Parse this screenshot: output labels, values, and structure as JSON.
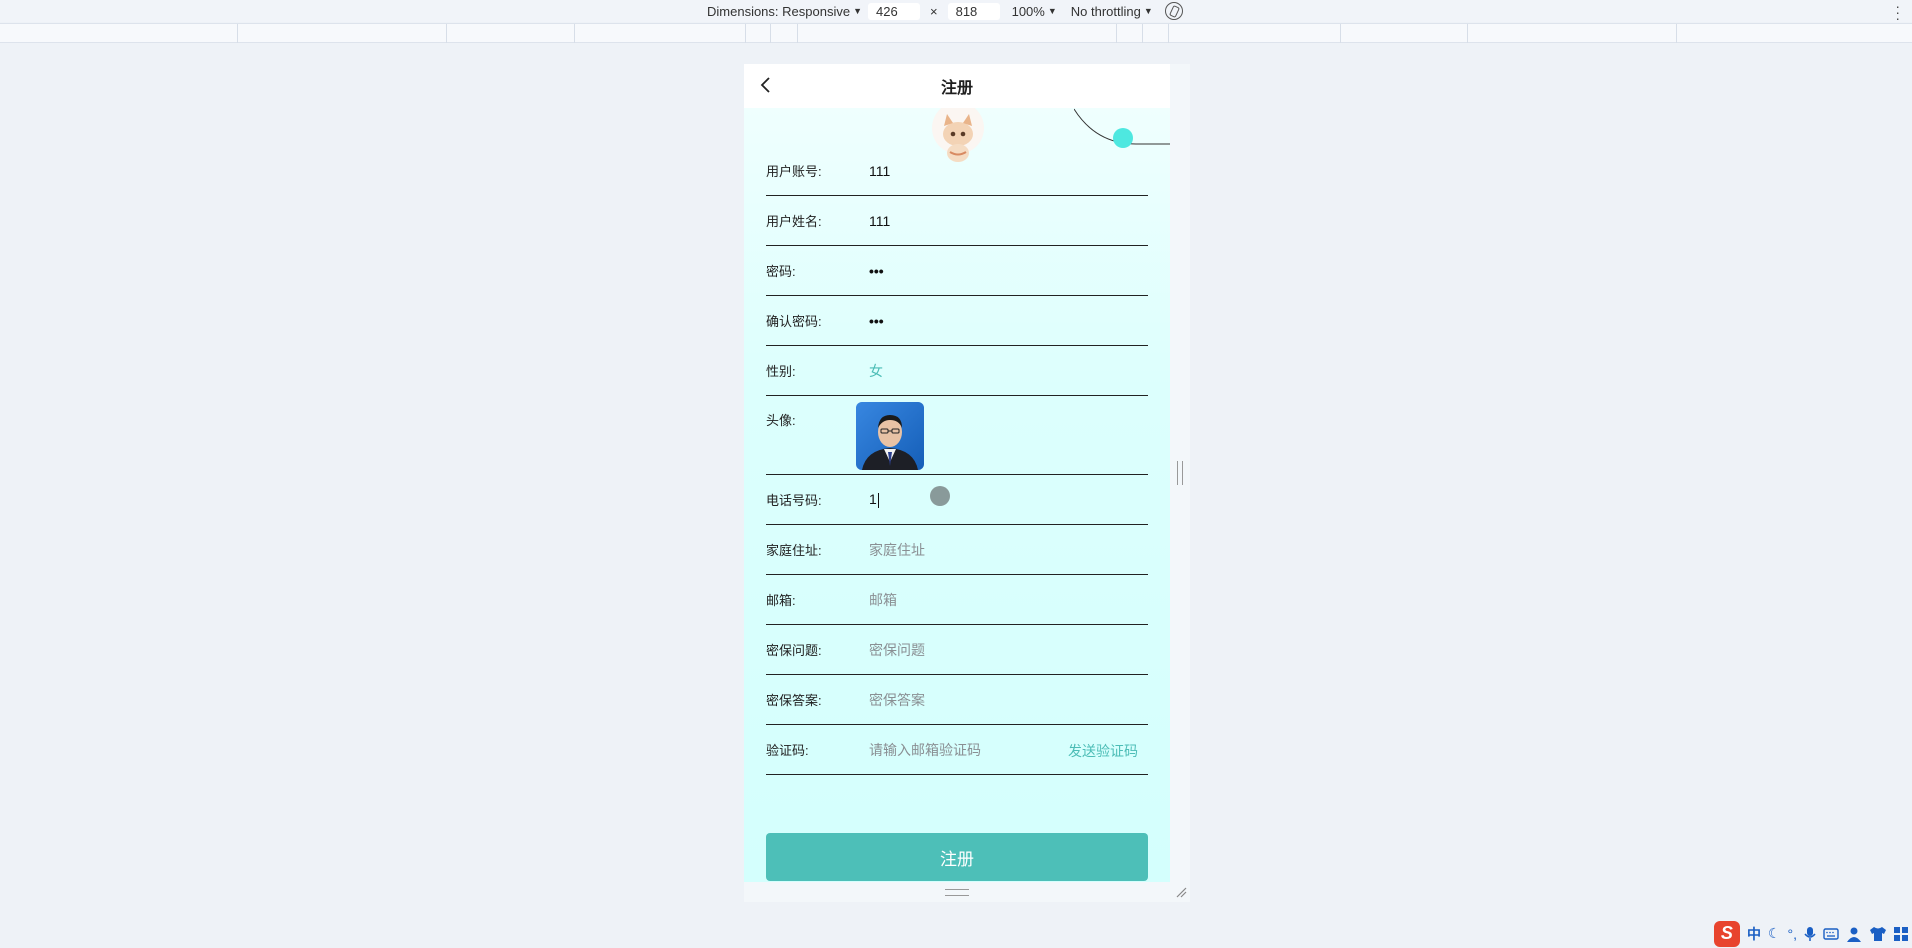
{
  "devtools": {
    "dimensions_label": "Dimensions: Responsive",
    "width": "426",
    "times": "×",
    "height": "818",
    "zoom": "100%",
    "throttling": "No throttling"
  },
  "page": {
    "title": "注册",
    "fields": [
      {
        "label": "用户账号:",
        "value": "111"
      },
      {
        "label": "用户姓名:",
        "value": "111"
      },
      {
        "label": "密码:",
        "value": "•••"
      },
      {
        "label": "确认密码:",
        "value": "•••"
      },
      {
        "label": "性别:",
        "value": "女"
      },
      {
        "label": "头像:"
      },
      {
        "label": "电话号码:",
        "value": "1"
      },
      {
        "label": "家庭住址:",
        "placeholder": "家庭住址"
      },
      {
        "label": "邮箱:",
        "placeholder": "邮箱"
      },
      {
        "label": "密保问题:",
        "placeholder": "密保问题"
      },
      {
        "label": "密保答案:",
        "placeholder": "密保答案"
      },
      {
        "label": "验证码:",
        "placeholder": "请输入邮箱验证码",
        "action": "发送验证码"
      }
    ],
    "submit_label": "注册"
  },
  "tray": {
    "ime_logo": "S",
    "ime_mode": "中",
    "punct": "°,"
  },
  "colors": {
    "accent": "#4dbfb8",
    "accent_text": "#4cbdb6",
    "orbit_dot": "#4ee8e0"
  }
}
